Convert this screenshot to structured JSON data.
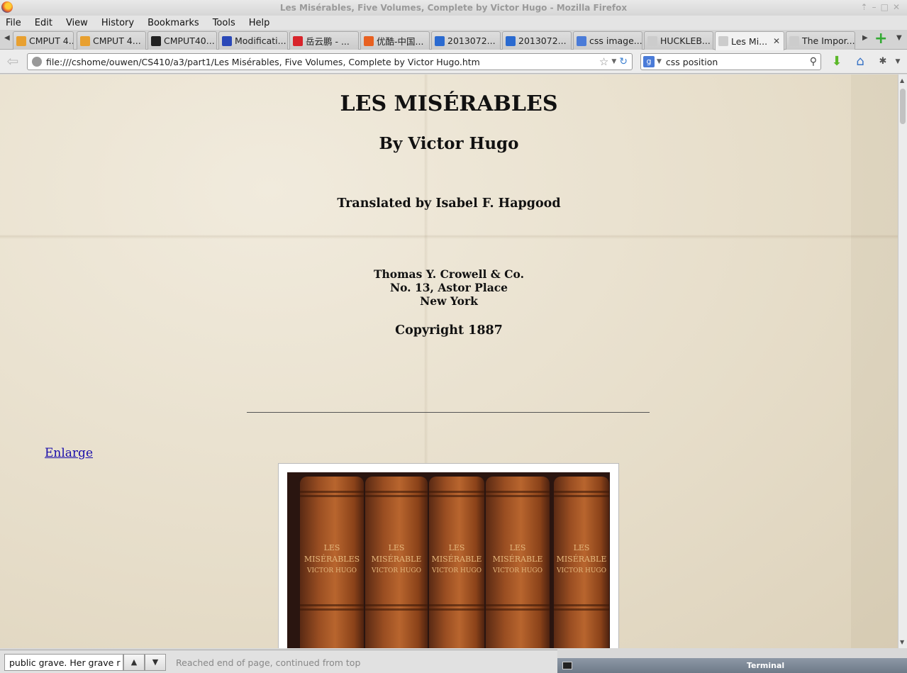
{
  "window": {
    "title": "Les Misérables, Five Volumes, Complete by Victor Hugo - Mozilla Firefox"
  },
  "menu": [
    "File",
    "Edit",
    "View",
    "History",
    "Bookmarks",
    "Tools",
    "Help"
  ],
  "tabs": [
    {
      "label": "CMPUT 4...",
      "color": "#e8a030"
    },
    {
      "label": "CMPUT 4...",
      "color": "#e8a030"
    },
    {
      "label": "CMPUT40...",
      "color": "#222222"
    },
    {
      "label": "Modificati...",
      "color": "#2a48b8"
    },
    {
      "label": "岳云鹏 - ...",
      "color": "#d8242b"
    },
    {
      "label": "优酷-中国...",
      "color": "#e86020"
    },
    {
      "label": "2013072...",
      "color": "#2a6ad0"
    },
    {
      "label": "2013072...",
      "color": "#2a6ad0"
    },
    {
      "label": "css image...",
      "color": "#4a7bd8"
    },
    {
      "label": "HUCKLEB...",
      "color": "#cccccc"
    },
    {
      "label": "Les Mi...",
      "color": "#cccccc",
      "active": true
    },
    {
      "label": "The Impor...",
      "color": "#cccccc"
    }
  ],
  "nav": {
    "url": "file:///cshome/ouwen/CS410/a3/part1/Les Misérables, Five Volumes, Complete by Victor Hugo.htm",
    "search_engine_letter": "g",
    "search_query": "css position"
  },
  "page": {
    "title": "LES MISÉRABLES",
    "author": "By Victor Hugo",
    "translator": "Translated by Isabel F. Hapgood",
    "publisher_lines": [
      "Thomas Y. Crowell & Co.",
      "No. 13, Astor Place",
      "New York"
    ],
    "copyright": "Copyright 1887",
    "enlarge_link": "Enlarge",
    "book_spines": [
      {
        "l1": "LES",
        "l2": "MISÉRABLES",
        "l3": "VICTOR HUGO"
      },
      {
        "l1": "LES",
        "l2": "MISÉRABLE",
        "l3": "VICTOR HUGO"
      },
      {
        "l1": "LES",
        "l2": "MISÉRABLE",
        "l3": "VICTOR HUGO"
      },
      {
        "l1": "LES",
        "l2": "MISÉRABLE",
        "l3": "VICTOR HUGO"
      },
      {
        "l1": "LES",
        "l2": "MISÉRABLE",
        "l3": "VICTOR HUGO"
      }
    ]
  },
  "findbar": {
    "query": "public grave. Her grave r",
    "status": "Reached end of page, continued from top"
  },
  "taskbar": {
    "label": "Terminal"
  }
}
